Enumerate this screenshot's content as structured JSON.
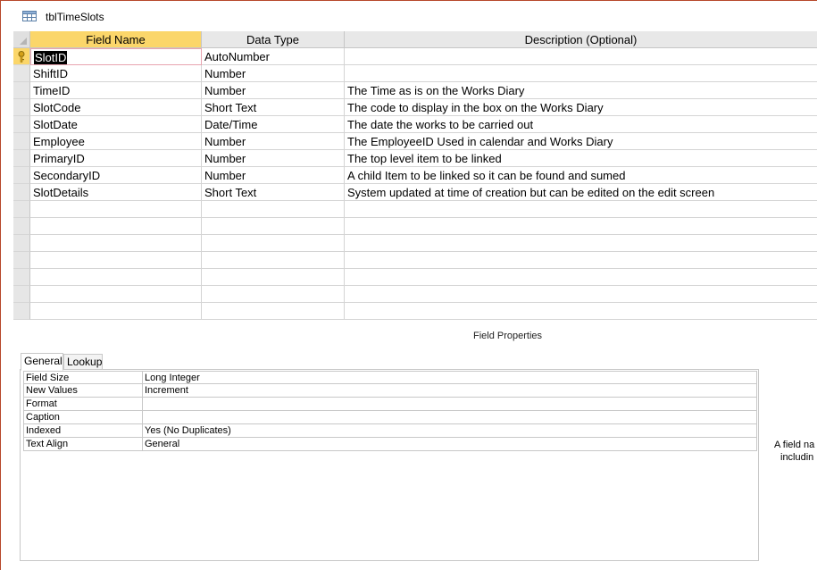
{
  "window": {
    "title": "tblTimeSlots",
    "icon": "table-icon"
  },
  "grid": {
    "headers": [
      "Field Name",
      "Data Type",
      "Description (Optional)"
    ],
    "rows": [
      {
        "field": "SlotID",
        "type": "AutoNumber",
        "desc": "",
        "primary_key": true
      },
      {
        "field": "ShiftID",
        "type": "Number",
        "desc": ""
      },
      {
        "field": "TimeID",
        "type": "Number",
        "desc": "The Time as is on the Works Diary"
      },
      {
        "field": "SlotCode",
        "type": "Short Text",
        "desc": "The code to display in the box on the Works Diary"
      },
      {
        "field": "SlotDate",
        "type": "Date/Time",
        "desc": "The date the works to be carried out"
      },
      {
        "field": "Employee",
        "type": "Number",
        "desc": "The EmployeeID Used in calendar and Works Diary"
      },
      {
        "field": "PrimaryID",
        "type": "Number",
        "desc": "The top level item to be linked"
      },
      {
        "field": "SecondaryID",
        "type": "Number",
        "desc": "A child Item to be linked so it can be found and sumed"
      },
      {
        "field": "SlotDetails",
        "type": "Short Text",
        "desc": "System updated at time of creation but can be edited on the edit screen"
      }
    ]
  },
  "field_properties": {
    "label": "Field Properties",
    "tabs": [
      "General",
      "Lookup"
    ],
    "properties": [
      {
        "name": "Field Size",
        "value": "Long Integer"
      },
      {
        "name": "New Values",
        "value": "Increment"
      },
      {
        "name": "Format",
        "value": ""
      },
      {
        "name": "Caption",
        "value": ""
      },
      {
        "name": "Indexed",
        "value": "Yes (No Duplicates)"
      },
      {
        "name": "Text Align",
        "value": "General"
      }
    ],
    "help_line1": "A field na",
    "help_line2": "includin"
  },
  "colors": {
    "accent": "#fbd66a",
    "border": "#b7472a"
  }
}
